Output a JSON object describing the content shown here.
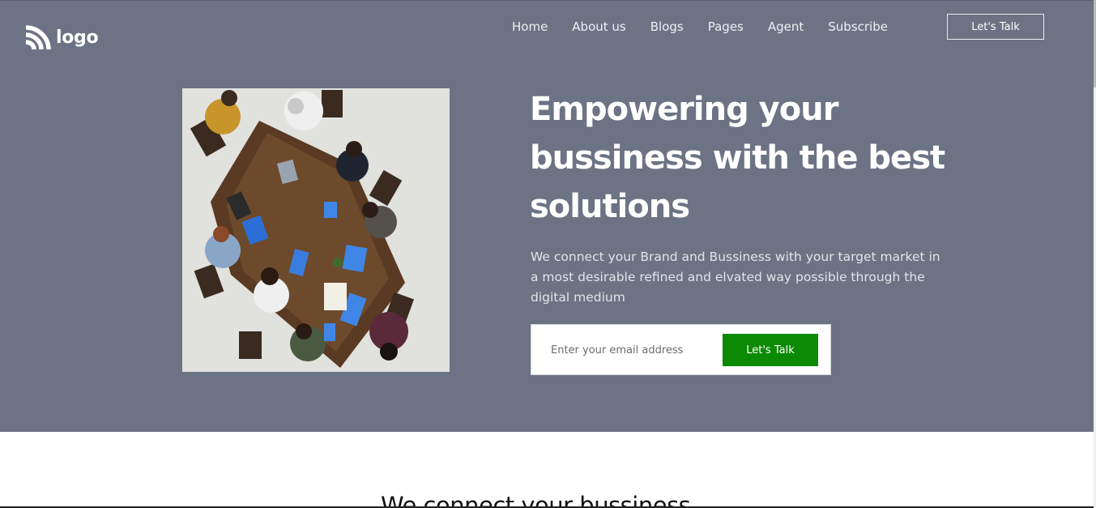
{
  "header": {
    "logo_text": "logo",
    "logo_icon": "signal-arcs-icon",
    "nav_items": [
      "Home",
      "About us",
      "Blogs",
      "Pages",
      "Agent",
      "Subscribe"
    ],
    "cta_label": "Let's Talk"
  },
  "hero": {
    "image_alt": "team meeting around a table, top view",
    "title": "Empowering your bussiness with the best solutions",
    "description": "We connect your Brand and Bussiness with your target market in a most desirable refined and elvated way possible through the digital medium",
    "form": {
      "email_placeholder": "Enter your email address",
      "submit_label": "Let's Talk"
    }
  },
  "section": {
    "heading": "We connect your bussiness"
  },
  "colors": {
    "hero_bg": "#6b7384",
    "accent_green": "#0b8a05",
    "text_light": "#ffffff"
  }
}
